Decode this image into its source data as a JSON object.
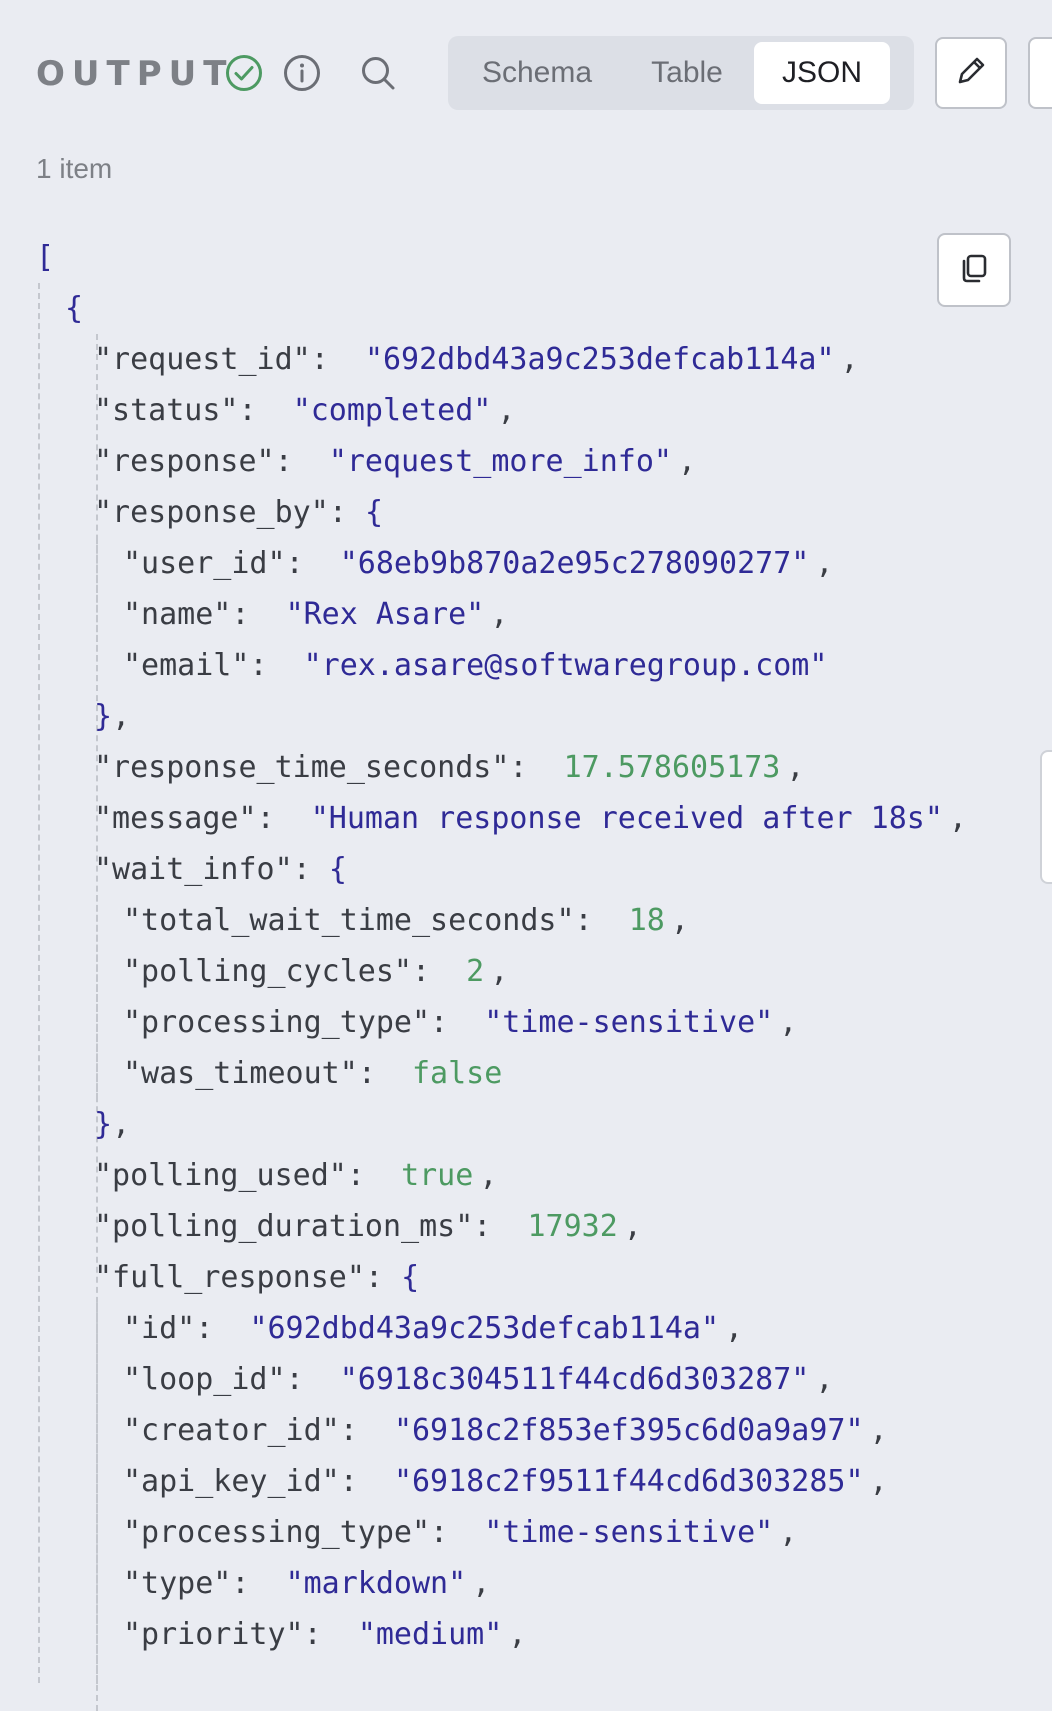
{
  "header": {
    "title": "OUTPUT",
    "tabs": [
      {
        "label": "Schema",
        "active": false
      },
      {
        "label": "Table",
        "active": false
      },
      {
        "label": "JSON",
        "active": true
      }
    ],
    "icons": [
      "check-circle-icon",
      "info-icon",
      "search-icon",
      "pencil-icon"
    ]
  },
  "item_count": "1 item",
  "json": {
    "open_bracket": "[",
    "open_brace": "{",
    "lines": [
      {
        "indent": 2,
        "key": "\"request_id\"",
        "value": "\"692dbd43a9c253defcab114a\"",
        "vtype": "string",
        "comma": ","
      },
      {
        "indent": 2,
        "key": "\"status\"",
        "value": "\"completed\"",
        "vtype": "string",
        "comma": ","
      },
      {
        "indent": 2,
        "key": "\"response\"",
        "value": "\"request_more_info\"",
        "vtype": "string",
        "comma": ","
      },
      {
        "indent": 2,
        "key": "\"response_by\"",
        "value": "{",
        "vtype": "brace",
        "comma": ""
      },
      {
        "indent": 3,
        "key": "\"user_id\"",
        "value": "\"68eb9b870a2e95c278090277\"",
        "vtype": "string",
        "comma": ","
      },
      {
        "indent": 3,
        "key": "\"name\"",
        "value": "\"Rex Asare\"",
        "vtype": "string",
        "comma": ","
      },
      {
        "indent": 3,
        "key": "\"email\"",
        "value": "\"rex.asare@softwaregroup.com\"",
        "vtype": "string",
        "comma": ""
      },
      {
        "indent": 2,
        "key": "",
        "value": "}",
        "vtype": "brace",
        "comma": ","
      },
      {
        "indent": 2,
        "key": "\"response_time_seconds\"",
        "value": "17.578605173",
        "vtype": "number",
        "comma": ","
      },
      {
        "indent": 2,
        "key": "\"message\"",
        "value": "\"Human response received after 18s\"",
        "vtype": "string",
        "comma": ","
      },
      {
        "indent": 2,
        "key": "\"wait_info\"",
        "value": "{",
        "vtype": "brace",
        "comma": ""
      },
      {
        "indent": 3,
        "key": "\"total_wait_time_seconds\"",
        "value": "18",
        "vtype": "number",
        "comma": ","
      },
      {
        "indent": 3,
        "key": "\"polling_cycles\"",
        "value": "2",
        "vtype": "number",
        "comma": ","
      },
      {
        "indent": 3,
        "key": "\"processing_type\"",
        "value": "\"time-sensitive\"",
        "vtype": "string",
        "comma": ","
      },
      {
        "indent": 3,
        "key": "\"was_timeout\"",
        "value": "false",
        "vtype": "bool",
        "comma": ""
      },
      {
        "indent": 2,
        "key": "",
        "value": "}",
        "vtype": "brace",
        "comma": ","
      },
      {
        "indent": 2,
        "key": "\"polling_used\"",
        "value": "true",
        "vtype": "bool",
        "comma": ","
      },
      {
        "indent": 2,
        "key": "\"polling_duration_ms\"",
        "value": "17932",
        "vtype": "number",
        "comma": ","
      },
      {
        "indent": 2,
        "key": "\"full_response\"",
        "value": "{",
        "vtype": "brace",
        "comma": ""
      },
      {
        "indent": 3,
        "key": "\"id\"",
        "value": "\"692dbd43a9c253defcab114a\"",
        "vtype": "string",
        "comma": ","
      },
      {
        "indent": 3,
        "key": "\"loop_id\"",
        "value": "\"6918c304511f44cd6d303287\"",
        "vtype": "string",
        "comma": ","
      },
      {
        "indent": 3,
        "key": "\"creator_id\"",
        "value": "\"6918c2f853ef395c6d0a9a97\"",
        "vtype": "string",
        "comma": ","
      },
      {
        "indent": 3,
        "key": "\"api_key_id\"",
        "value": "\"6918c2f9511f44cd6d303285\"",
        "vtype": "string",
        "comma": ","
      },
      {
        "indent": 3,
        "key": "\"processing_type\"",
        "value": "\"time-sensitive\"",
        "vtype": "string",
        "comma": ","
      },
      {
        "indent": 3,
        "key": "\"type\"",
        "value": "\"markdown\"",
        "vtype": "string",
        "comma": ","
      },
      {
        "indent": 3,
        "key": "\"priority\"",
        "value": "\"medium\"",
        "vtype": "string",
        "comma": ","
      }
    ]
  },
  "colors": {
    "key": "#3a3d44",
    "string": "#2f2a96",
    "number": "#4d9a62",
    "success": "#4d9a62"
  }
}
